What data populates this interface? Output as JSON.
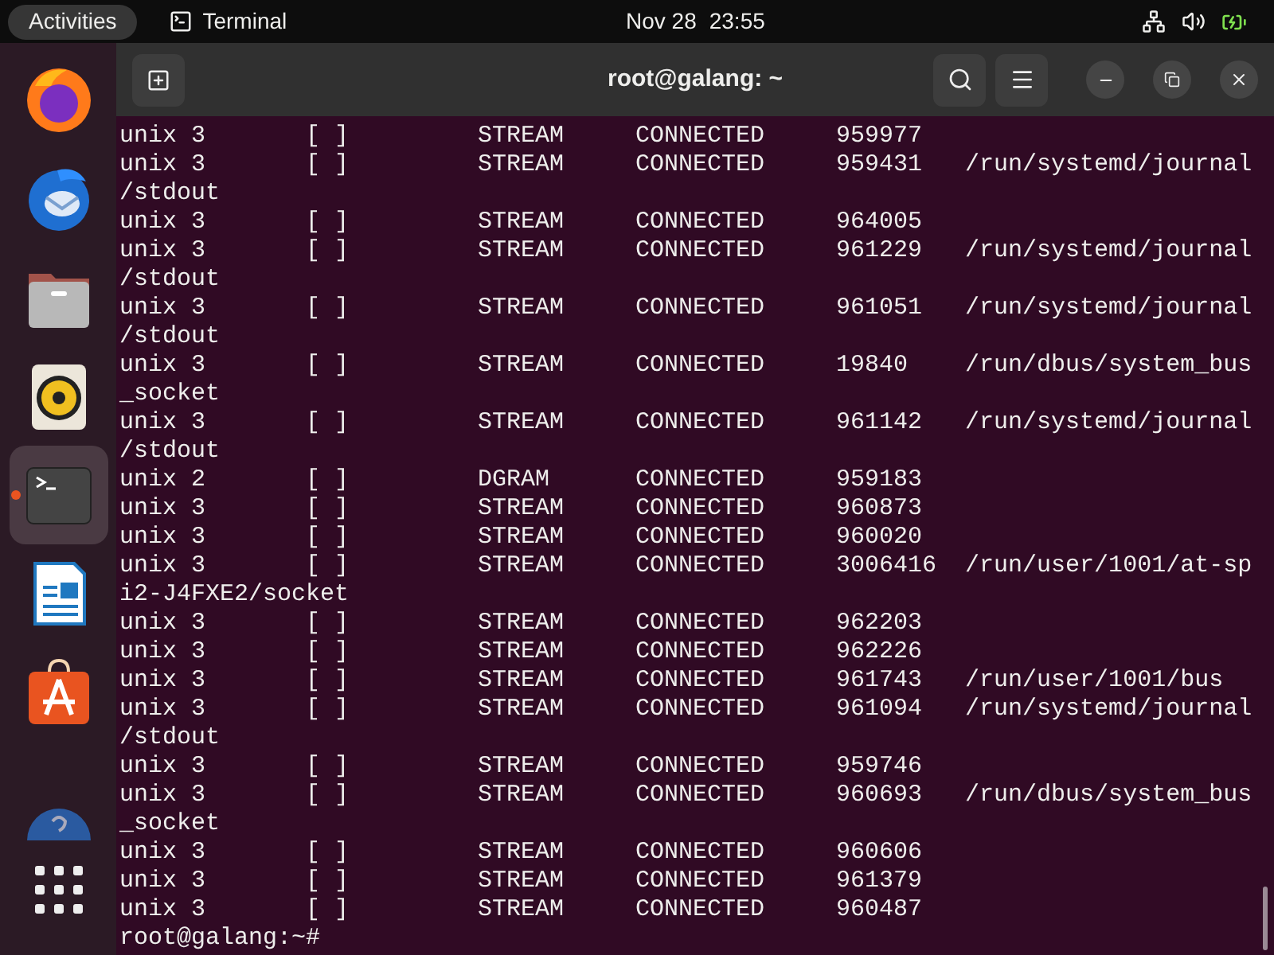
{
  "top_bar": {
    "activities": "Activities",
    "app": "Terminal",
    "date": "Nov 28",
    "time": "23:55"
  },
  "dock": [
    {
      "kind": "browser",
      "running": false,
      "selected": false
    },
    {
      "kind": "mail",
      "running": false,
      "selected": false
    },
    {
      "kind": "files",
      "running": false,
      "selected": false
    },
    {
      "kind": "music",
      "running": false,
      "selected": false
    },
    {
      "kind": "terminal",
      "running": true,
      "selected": true
    },
    {
      "kind": "writer",
      "running": false,
      "selected": false
    },
    {
      "kind": "store",
      "running": false,
      "selected": false
    },
    {
      "kind": "help",
      "running": false,
      "selected": false
    },
    {
      "kind": "apps",
      "running": false,
      "selected": false
    }
  ],
  "window": {
    "title": "root@galang: ~"
  },
  "lines": [
    {
      "kind": "row",
      "cells": [
        "unix",
        "3",
        "[ ]",
        "STREAM",
        "CONNECTED",
        "959977"
      ]
    },
    {
      "kind": "row",
      "cells": [
        "unix",
        "3",
        "[ ]",
        "STREAM",
        "CONNECTED",
        "959431",
        "/run/systemd/journal"
      ]
    },
    {
      "kind": "wrap",
      "text": "/stdout"
    },
    {
      "kind": "row",
      "cells": [
        "unix",
        "3",
        "[ ]",
        "STREAM",
        "CONNECTED",
        "964005"
      ]
    },
    {
      "kind": "row",
      "cells": [
        "unix",
        "3",
        "[ ]",
        "STREAM",
        "CONNECTED",
        "961229",
        "/run/systemd/journal"
      ]
    },
    {
      "kind": "wrap",
      "text": "/stdout"
    },
    {
      "kind": "row",
      "cells": [
        "unix",
        "3",
        "[ ]",
        "STREAM",
        "CONNECTED",
        "961051",
        "/run/systemd/journal"
      ]
    },
    {
      "kind": "wrap",
      "text": "/stdout"
    },
    {
      "kind": "row",
      "cells": [
        "unix",
        "3",
        "[ ]",
        "STREAM",
        "CONNECTED",
        "19840",
        "/run/dbus/system_bus"
      ]
    },
    {
      "kind": "wrap",
      "text": "_socket"
    },
    {
      "kind": "row",
      "cells": [
        "unix",
        "3",
        "[ ]",
        "STREAM",
        "CONNECTED",
        "961142",
        "/run/systemd/journal"
      ]
    },
    {
      "kind": "wrap",
      "text": "/stdout"
    },
    {
      "kind": "row",
      "cells": [
        "unix",
        "2",
        "[ ]",
        "DGRAM",
        "CONNECTED",
        "959183"
      ]
    },
    {
      "kind": "row",
      "cells": [
        "unix",
        "3",
        "[ ]",
        "STREAM",
        "CONNECTED",
        "960873"
      ]
    },
    {
      "kind": "row",
      "cells": [
        "unix",
        "3",
        "[ ]",
        "STREAM",
        "CONNECTED",
        "960020"
      ]
    },
    {
      "kind": "row",
      "cells": [
        "unix",
        "3",
        "[ ]",
        "STREAM",
        "CONNECTED",
        "3006416",
        "/run/user/1001/at-sp"
      ]
    },
    {
      "kind": "wrap",
      "text": "i2-J4FXE2/socket"
    },
    {
      "kind": "row",
      "cells": [
        "unix",
        "3",
        "[ ]",
        "STREAM",
        "CONNECTED",
        "962203"
      ]
    },
    {
      "kind": "row",
      "cells": [
        "unix",
        "3",
        "[ ]",
        "STREAM",
        "CONNECTED",
        "962226"
      ]
    },
    {
      "kind": "row",
      "cells": [
        "unix",
        "3",
        "[ ]",
        "STREAM",
        "CONNECTED",
        "961743",
        "/run/user/1001/bus"
      ]
    },
    {
      "kind": "row",
      "cells": [
        "unix",
        "3",
        "[ ]",
        "STREAM",
        "CONNECTED",
        "961094",
        "/run/systemd/journal"
      ]
    },
    {
      "kind": "wrap",
      "text": "/stdout"
    },
    {
      "kind": "row",
      "cells": [
        "unix",
        "3",
        "[ ]",
        "STREAM",
        "CONNECTED",
        "959746"
      ]
    },
    {
      "kind": "row",
      "cells": [
        "unix",
        "3",
        "[ ]",
        "STREAM",
        "CONNECTED",
        "960693",
        "/run/dbus/system_bus"
      ]
    },
    {
      "kind": "wrap",
      "text": "_socket"
    },
    {
      "kind": "row",
      "cells": [
        "unix",
        "3",
        "[ ]",
        "STREAM",
        "CONNECTED",
        "960606"
      ]
    },
    {
      "kind": "row",
      "cells": [
        "unix",
        "3",
        "[ ]",
        "STREAM",
        "CONNECTED",
        "961379"
      ]
    },
    {
      "kind": "row",
      "cells": [
        "unix",
        "3",
        "[ ]",
        "STREAM",
        "CONNECTED",
        "960487"
      ]
    },
    {
      "kind": "prompt",
      "text": "root@galang:~#"
    }
  ]
}
